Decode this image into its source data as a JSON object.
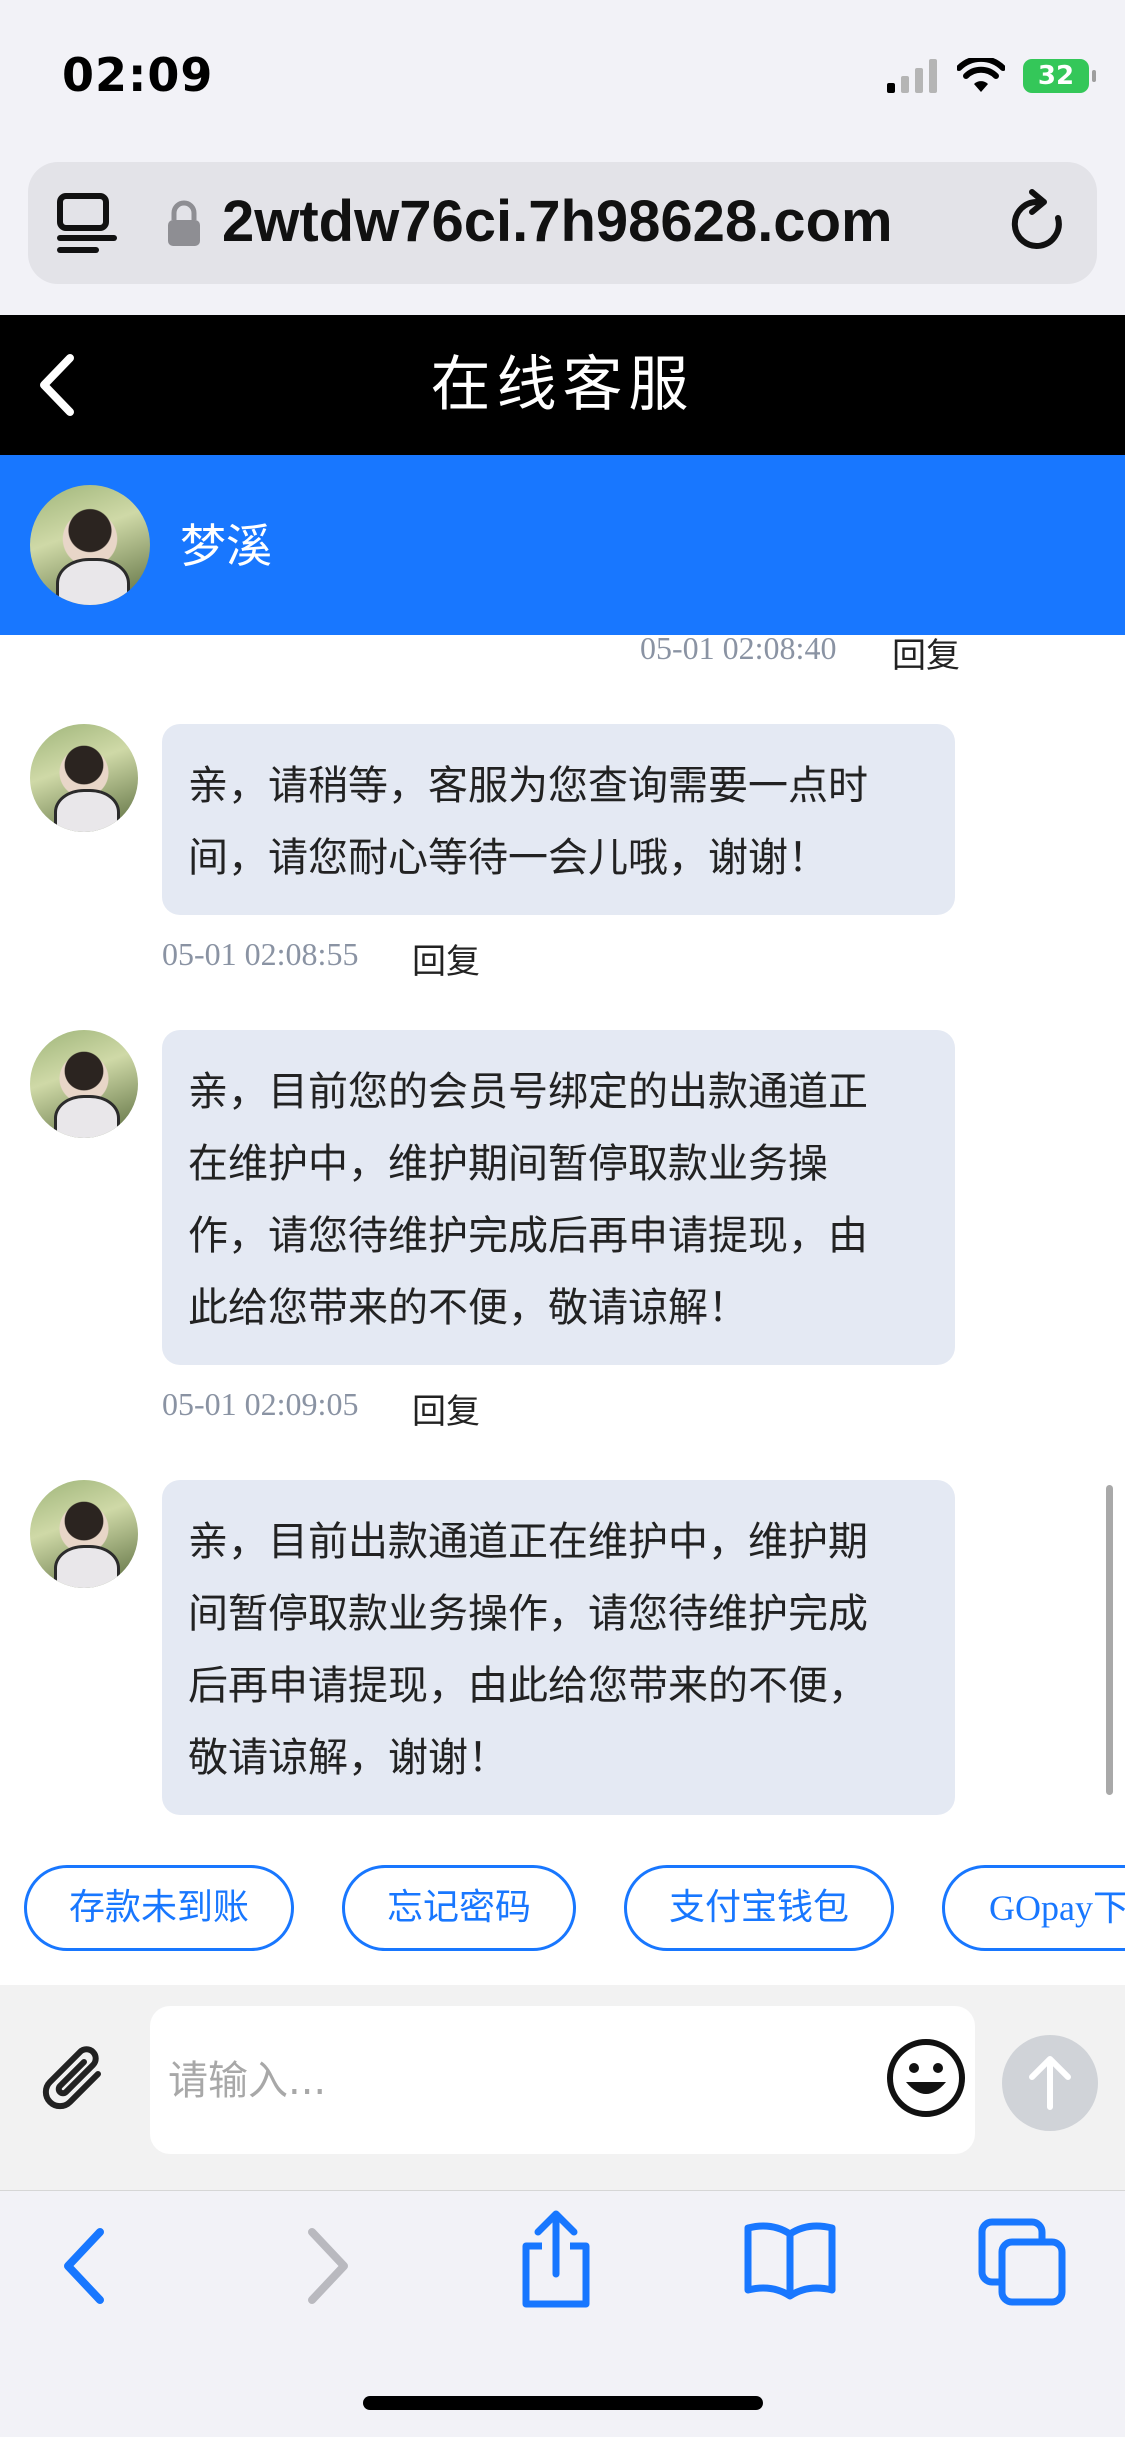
{
  "status_bar": {
    "time": "02:09",
    "battery": "32"
  },
  "browser": {
    "url": "2wtdw76ci.7h98628.com"
  },
  "header": {
    "title": "在线客服"
  },
  "agent": {
    "name": "梦溪"
  },
  "messages": [
    {
      "timestamp": "05-01 02:08:40",
      "reply_label": "回复",
      "text": ""
    },
    {
      "text": "亲，请稍等，客服为您查询需要一点时\n间，请您耐心等待一会儿哦，谢谢！",
      "timestamp": "05-01 02:08:55",
      "reply_label": "回复"
    },
    {
      "text": "亲，目前您的会员号绑定的出款通道正\n在维护中，维护期间暂停取款业务操\n作，请您待维护完成后再申请提现，由\n此给您带来的不便，敬请谅解！",
      "timestamp": "05-01 02:09:05",
      "reply_label": "回复"
    },
    {
      "text": "亲，目前出款通道正在维护中，维护期\n间暂停取款业务操作，请您待维护完成\n后再申请提现，由此给您带来的不便，\n敬请谅解，谢谢！"
    }
  ],
  "quick_replies": [
    "存款未到账",
    "忘记密码",
    "支付宝钱包",
    "GOpay下"
  ],
  "input": {
    "placeholder": "请输入..."
  },
  "icons": {
    "reader": "reader-icon",
    "lock": "lock-icon",
    "reload": "reload-icon",
    "back": "back-chevron-icon",
    "attach": "paperclip-icon",
    "emoji": "emoji-icon",
    "send": "send-arrow-icon",
    "safari_back": "back-icon",
    "safari_forward": "forward-icon",
    "share": "share-icon",
    "bookmarks": "bookmarks-icon",
    "tabs": "tabs-icon"
  },
  "colors": {
    "accent": "#1877ff",
    "header": "#000000",
    "bubble": "#e4e9f3",
    "battery": "#34c759"
  }
}
